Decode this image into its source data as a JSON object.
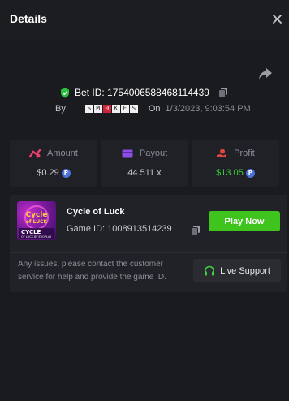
{
  "header": {
    "title": "Details"
  },
  "bet": {
    "id_label": "Bet ID: 1754006588468114439",
    "by_label": "By",
    "user_chars": [
      "S",
      "M",
      "0",
      "K",
      "E",
      "S"
    ],
    "on_label": "On",
    "date": "1/3/2023, 9:03:54 PM"
  },
  "stats": [
    {
      "label": "Amount",
      "value": "$0.29",
      "coin": true,
      "icon": "coins-icon",
      "color": "#e8406a"
    },
    {
      "label": "Payout",
      "value": "44.511 x",
      "coin": false,
      "icon": "card-icon",
      "color": "#8a4fe0"
    },
    {
      "label": "Profit",
      "value": "$13.05",
      "coin": true,
      "icon": "hand-coin-icon",
      "color": "#e0463f",
      "value_color": "#3bd13b"
    }
  ],
  "coin_symbol": "P",
  "game": {
    "name": "Cycle of Luck",
    "id_label": "Game ID: 1008913514239",
    "play_label": "Play Now",
    "thumb_title": "Cycle of Luck",
    "thumb_sub": "CYCLE",
    "thumb_caption": "OF LUCK BY EVOPLAY"
  },
  "support": {
    "help_text": "Any issues, please contact the customer service for help and provide the game ID.",
    "button_label": "Live Support"
  },
  "colors": {
    "accent_green": "#3ec41d",
    "badge_green": "#3bd13b",
    "panel": "#202126"
  }
}
